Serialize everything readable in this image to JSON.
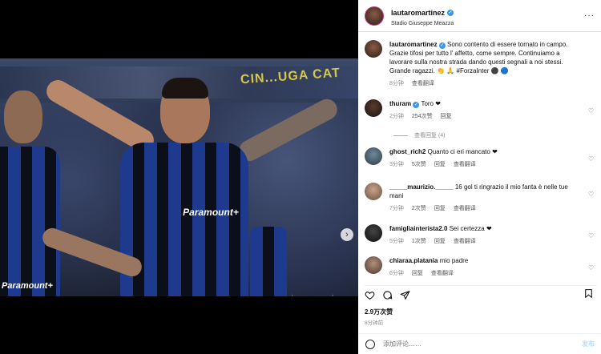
{
  "header": {
    "username": "lautaromartinez",
    "location": "Stadio Giuseppe Meazza",
    "more": "···"
  },
  "photo": {
    "banner": "CIN...UGA CAT",
    "main_logo": "Paramount+",
    "left_logo": "Paramount+",
    "slide_count": 5,
    "active_slide": 0
  },
  "caption": {
    "username": "lautaromartinez",
    "text": "Sono contento di essere tornato in campo. Grazie tifosi per tutto l' affetto, come sempre. Continuiamo a lavorare sulla nostra strada dando questi segnali a noi stessi. Grande ragazzi. 👏 🙏 #ForzaInter ⚫ 🔵",
    "time": "8分钟",
    "translate": "查看翻译"
  },
  "comments": [
    {
      "username": "thuram",
      "verified": true,
      "text": "Toro ❤",
      "time": "2分钟",
      "likes": "254次赞",
      "reply": "回复",
      "view_replies": "查看回复 (4)"
    },
    {
      "username": "ghost_rich2",
      "verified": false,
      "text": "Quanto ci eri mancato ❤",
      "time": "3分钟",
      "likes": "5次赞",
      "reply": "回复",
      "translate": "查看翻译"
    },
    {
      "username": "_____maurizio._____",
      "verified": false,
      "text": "16 gol ti ringrazio il mio fanta è nelle tue mani",
      "time": "7分钟",
      "likes": "2次赞",
      "reply": "回复",
      "translate": "查看翻译"
    },
    {
      "username": "famigliainterista2.0",
      "verified": false,
      "text": "Sei certezza ❤",
      "time": "5分钟",
      "likes": "1次赞",
      "reply": "回复",
      "translate": "查看翻译"
    },
    {
      "username": "chiaraa.platania",
      "verified": false,
      "text": "mio padre",
      "time": "6分钟",
      "likes": "",
      "reply": "回复",
      "translate": "查看翻译"
    }
  ],
  "stats": {
    "likes": "2.9万次赞",
    "posted": "8分钟前"
  },
  "composer": {
    "placeholder": "添加评论……",
    "post_label": "发布"
  }
}
